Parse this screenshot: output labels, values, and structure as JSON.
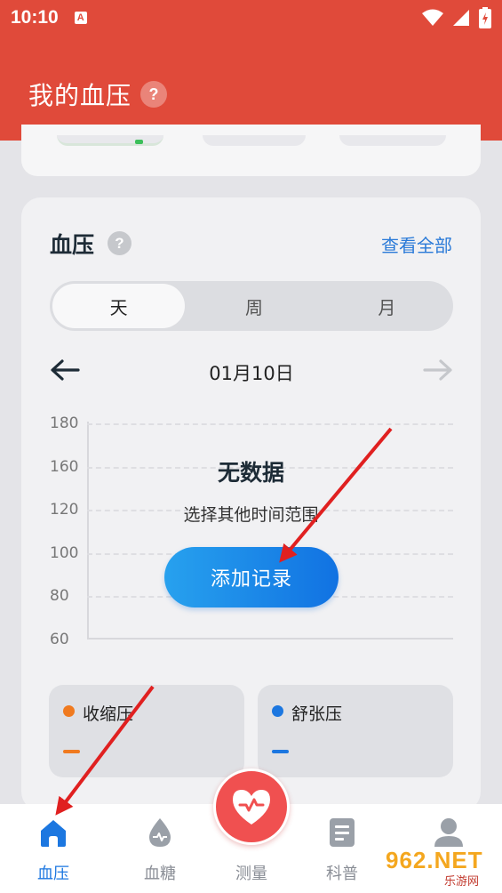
{
  "status_bar": {
    "time": "10:10",
    "notif_letter": "A"
  },
  "header": {
    "title": "我的血压",
    "help": "?"
  },
  "bp_card": {
    "title": "血压",
    "help": "?",
    "view_all": "查看全部",
    "tabs": [
      {
        "label": "天",
        "active": true
      },
      {
        "label": "周"
      },
      {
        "label": "月"
      }
    ],
    "date": "01月10日",
    "chart_data": {
      "type": "line",
      "y_ticks": [
        "180",
        "160",
        "120",
        "100",
        "80",
        "60"
      ],
      "series": [],
      "empty_title": "无数据",
      "empty_subtitle": "选择其他时间范围"
    },
    "add_button": "添加记录",
    "stats": [
      {
        "label": "收缩压",
        "value": "",
        "color": "#f07a1f"
      },
      {
        "label": "舒张压",
        "value": "",
        "color": "#1c77e0"
      }
    ]
  },
  "bottom_nav": {
    "items": [
      {
        "label": "血压",
        "icon": "home-icon",
        "active": true
      },
      {
        "label": "血糖",
        "icon": "blood-drop-icon"
      },
      {
        "label": "测量",
        "icon": "heart-icon"
      },
      {
        "label": "科普",
        "icon": "article-icon"
      },
      {
        "label": "",
        "icon": "profile-icon"
      }
    ]
  },
  "colors": {
    "primary": "#e04a3a",
    "accent": "#1c77e0",
    "systolic": "#f07a1f",
    "diastolic": "#1c77e0"
  },
  "watermark": {
    "text": "962.NET",
    "sub": "乐游网"
  }
}
